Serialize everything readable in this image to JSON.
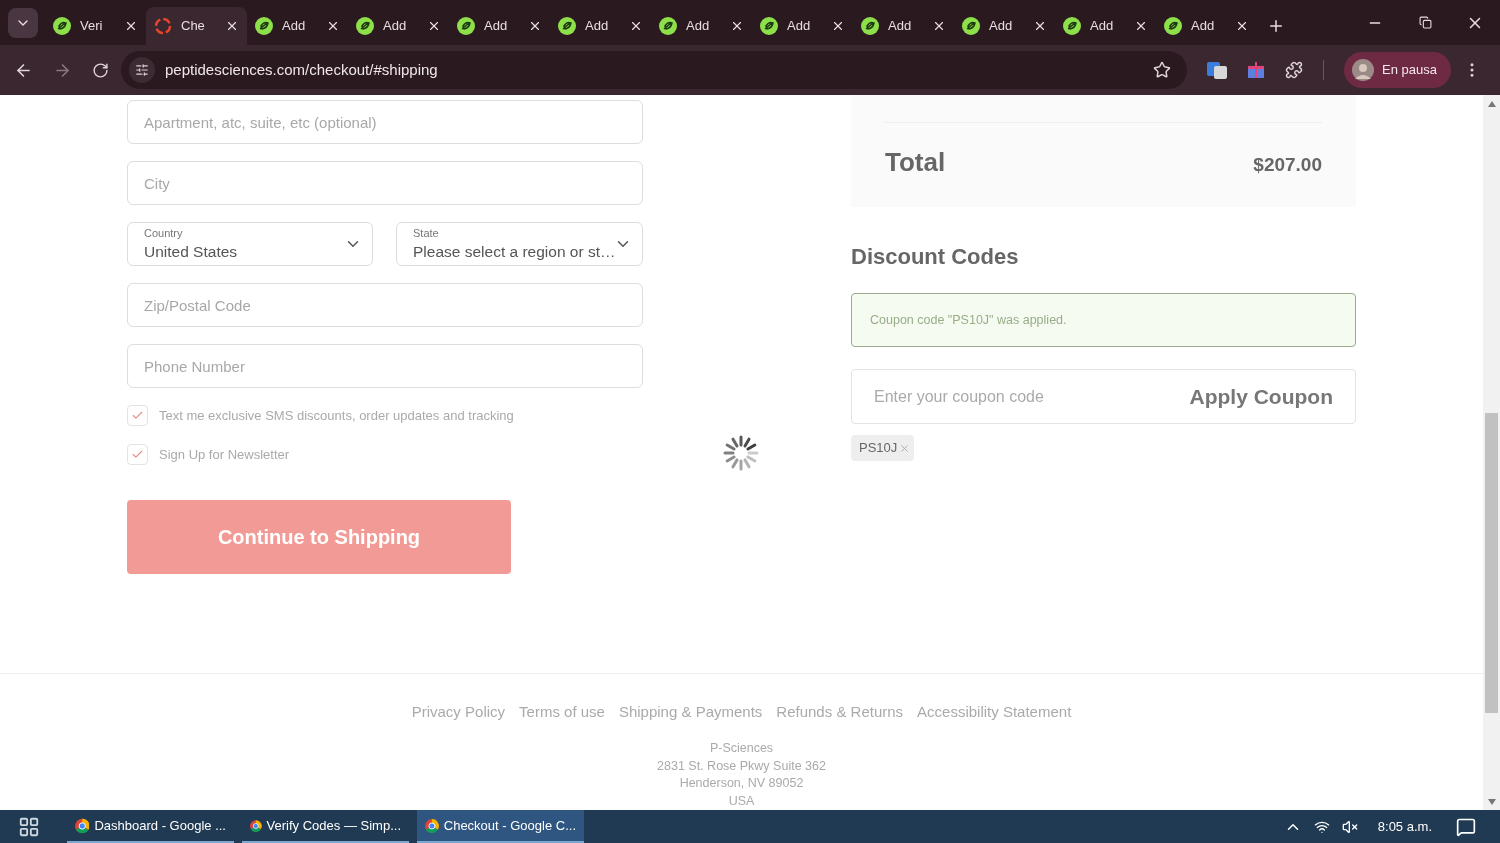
{
  "browser": {
    "tabs": [
      {
        "title": "Veri",
        "selected": false,
        "kind": "lime"
      },
      {
        "title": "Che",
        "selected": true,
        "kind": "swirl"
      },
      {
        "title": "Add",
        "selected": false,
        "kind": "lime"
      },
      {
        "title": "Add",
        "selected": false,
        "kind": "lime"
      },
      {
        "title": "Add",
        "selected": false,
        "kind": "lime"
      },
      {
        "title": "Add",
        "selected": false,
        "kind": "lime"
      },
      {
        "title": "Add",
        "selected": false,
        "kind": "lime"
      },
      {
        "title": "Add",
        "selected": false,
        "kind": "lime"
      },
      {
        "title": "Add",
        "selected": false,
        "kind": "lime"
      },
      {
        "title": "Add",
        "selected": false,
        "kind": "lime"
      },
      {
        "title": "Add",
        "selected": false,
        "kind": "lime"
      },
      {
        "title": "Add",
        "selected": false,
        "kind": "lime"
      }
    ],
    "url": "peptidesciences.com/checkout/#shipping",
    "profile": "En pausa"
  },
  "form": {
    "fields": [
      {
        "kind": "text",
        "placeholder": "Apartment, atc, suite, etc (optional)"
      },
      {
        "kind": "text",
        "placeholder": "City"
      },
      {
        "kind": "selects",
        "items": [
          {
            "label": "Country",
            "value": "United States"
          },
          {
            "label": "State",
            "value": "Please select a region or st…"
          }
        ]
      },
      {
        "kind": "text",
        "placeholder": "Zip/Postal Code"
      },
      {
        "kind": "text",
        "placeholder": "Phone Number"
      }
    ],
    "checkboxes": [
      {
        "label": "Text me exclusive SMS discounts, order updates and tracking",
        "checked": true
      },
      {
        "label": "Sign Up for Newsletter",
        "checked": true
      }
    ],
    "submit": "Continue to Shipping"
  },
  "summary": {
    "total_label": "Total",
    "total_value": "$207.00"
  },
  "discount": {
    "title": "Discount Codes",
    "notice": "Coupon code \"PS10J\" was applied.",
    "placeholder": "Enter your coupon code",
    "apply": "Apply Coupon",
    "tags": [
      "PS10J"
    ]
  },
  "footer": {
    "links": [
      "Privacy Policy",
      "Terms of use",
      "Shipping & Payments",
      "Refunds & Returns",
      "Accessibility Statement"
    ],
    "address": [
      "P-Sciences",
      "2831 St. Rose Pkwy Suite 362",
      "Henderson, NV 89052",
      "USA"
    ]
  },
  "taskbar": {
    "apps": [
      {
        "title": "Dashboard - Google ...",
        "selected": false
      },
      {
        "title": "Verify Codes — Simp...",
        "selected": false
      },
      {
        "title": "Checkout - Google C...",
        "selected": true
      }
    ],
    "time": "8:05 a.m."
  }
}
